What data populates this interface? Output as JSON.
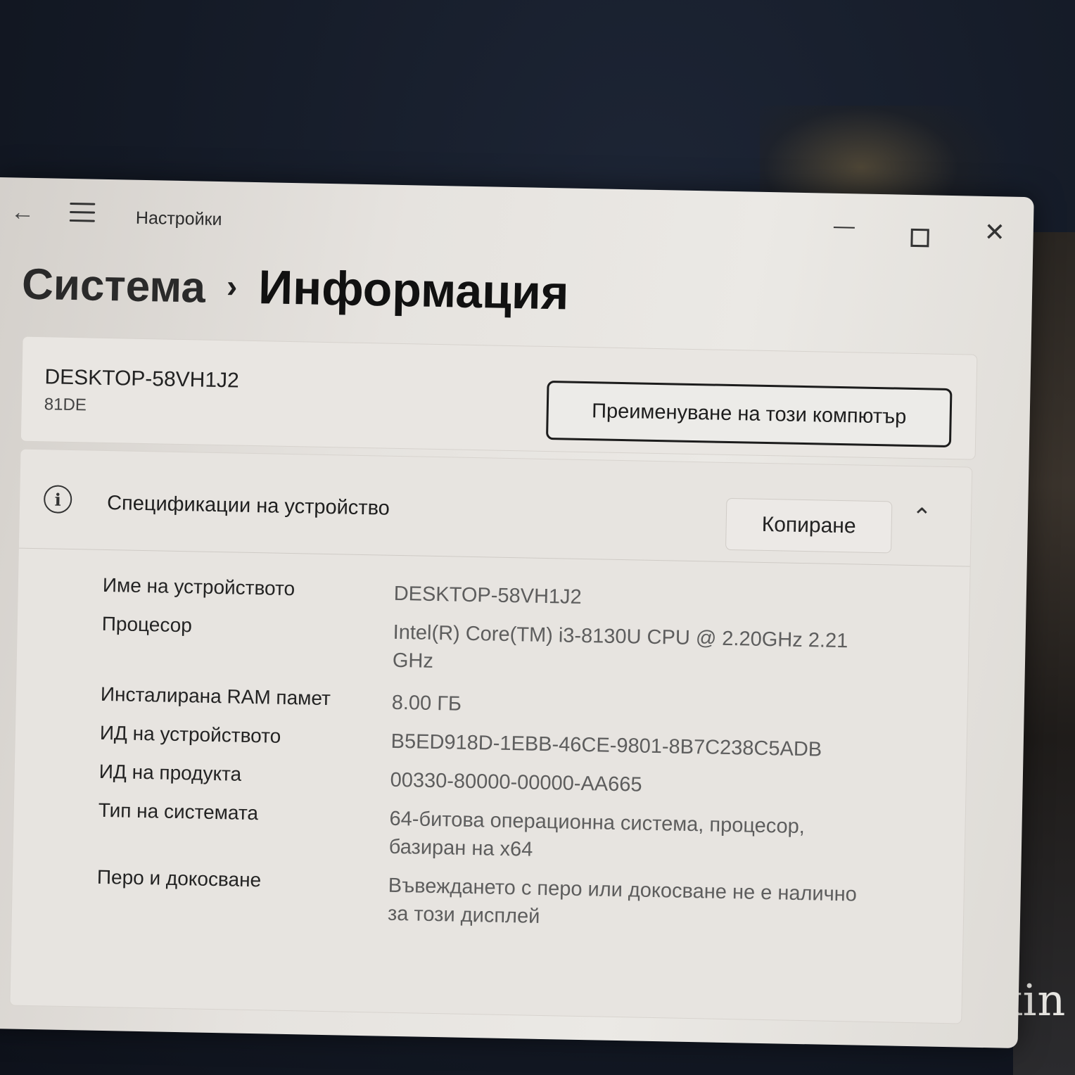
{
  "window": {
    "app_title": "Настройки",
    "back_icon": "back-arrow-icon",
    "menu_icon": "hamburger-menu-icon",
    "min_icon": "minimize-icon",
    "max_icon": "maximize-icon",
    "close_icon": "close-icon"
  },
  "breadcrumb": {
    "parent": "Система",
    "separator": "›",
    "current": "Информация"
  },
  "device": {
    "name": "DESKTOP-58VH1J2",
    "model": "81DE",
    "rename_label": "Преименуване на този компютър"
  },
  "specs": {
    "title": "Спецификации на устройство",
    "copy_label": "Копиране",
    "info_icon_glyph": "i",
    "rows": [
      {
        "label": "Име на устройството",
        "value": "DESKTOP-58VH1J2"
      },
      {
        "label": "Процесор",
        "value": "Intel(R) Core(TM) i3-8130U CPU @ 2.20GHz   2.21 GHz"
      },
      {
        "label": "Инсталирана RAM памет",
        "value": "8.00 ГБ"
      },
      {
        "label": "ИД на устройството",
        "value": "B5ED918D-1EBB-46CE-9801-8B7C238C5ADB"
      },
      {
        "label": "ИД на продукта",
        "value": "00330-80000-00000-AA665"
      },
      {
        "label": "Тип на системата",
        "value": "64-битова операционна система, процесор, базиран на x64"
      },
      {
        "label": "Перо и докосване",
        "value": "Въвеждането с перо или докосване не е налично за този дисплей"
      }
    ]
  },
  "background": {
    "partial_text": "kin"
  }
}
